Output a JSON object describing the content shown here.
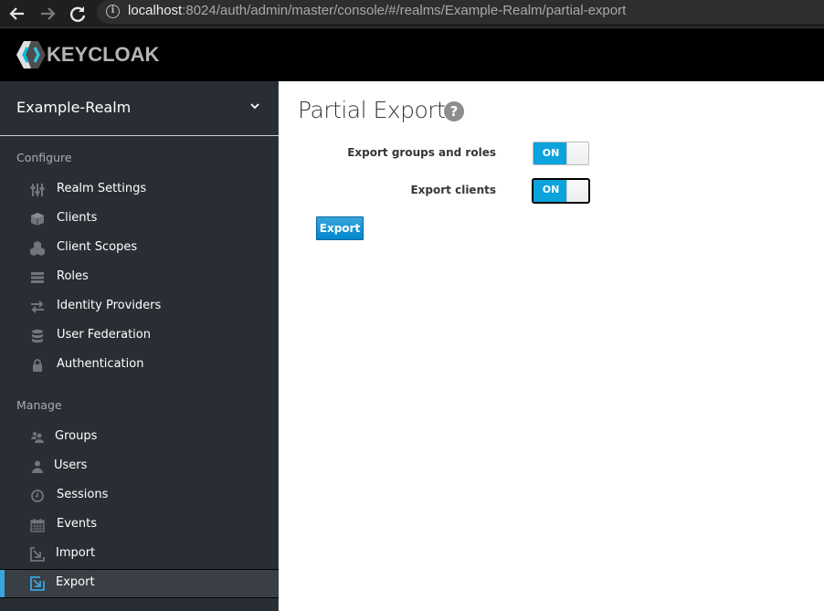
{
  "browser": {
    "back_icon": "arrow-left-icon",
    "forward_icon": "arrow-right-icon",
    "reload_icon": "reload-icon",
    "site_info_icon": "info-icon",
    "url_host": "localhost",
    "url_rest": ":8024/auth/admin/master/console/#/realms/Example-Realm/partial-export"
  },
  "header": {
    "logo_text": "KEYCLOAK"
  },
  "sidebar": {
    "realm": "Example-Realm",
    "configure_label": "Configure",
    "configure_items": [
      {
        "label": "Realm Settings",
        "icon": "sliders-icon"
      },
      {
        "label": "Clients",
        "icon": "cube-icon"
      },
      {
        "label": "Client Scopes",
        "icon": "cubes-icon"
      },
      {
        "label": "Roles",
        "icon": "server-icon"
      },
      {
        "label": "Identity Providers",
        "icon": "exchange-icon"
      },
      {
        "label": "User Federation",
        "icon": "database-icon"
      },
      {
        "label": "Authentication",
        "icon": "lock-icon"
      }
    ],
    "manage_label": "Manage",
    "manage_items": [
      {
        "label": "Groups",
        "icon": "users-icon"
      },
      {
        "label": "Users",
        "icon": "user-icon"
      },
      {
        "label": "Sessions",
        "icon": "clock-icon"
      },
      {
        "label": "Events",
        "icon": "calendar-icon"
      },
      {
        "label": "Import",
        "icon": "import-icon"
      },
      {
        "label": "Export",
        "icon": "export-icon",
        "active": true
      }
    ]
  },
  "main": {
    "title": "Partial Export",
    "fields": [
      {
        "label": "Export groups and roles",
        "value": "ON"
      },
      {
        "label": "Export clients",
        "value": "ON"
      }
    ],
    "export_button": "Export"
  },
  "colors": {
    "accent": "#0ca3dd",
    "sidebar_bg": "#292e34",
    "active_bar": "#39a5dc"
  }
}
